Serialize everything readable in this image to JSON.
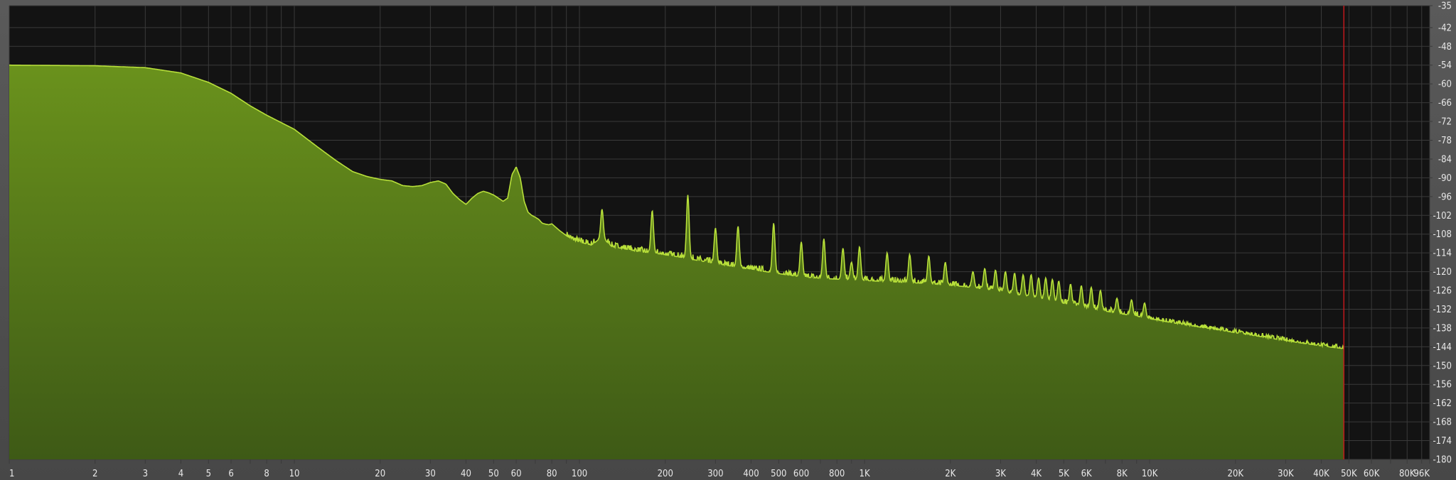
{
  "chart_data": {
    "type": "area",
    "title": "",
    "xlabel": "",
    "ylabel": "",
    "x_scale": "log",
    "y_unit": "dB",
    "xlim": [
      1,
      96000
    ],
    "ylim": [
      -180,
      -35
    ],
    "grid": true,
    "x_tick_labels": [
      {
        "value": 1,
        "label": "1"
      },
      {
        "value": 2,
        "label": "2"
      },
      {
        "value": 3,
        "label": "3"
      },
      {
        "value": 4,
        "label": "4"
      },
      {
        "value": 5,
        "label": "5"
      },
      {
        "value": 6,
        "label": "6"
      },
      {
        "value": 8,
        "label": "8"
      },
      {
        "value": 10,
        "label": "10"
      },
      {
        "value": 20,
        "label": "20"
      },
      {
        "value": 30,
        "label": "30"
      },
      {
        "value": 40,
        "label": "40"
      },
      {
        "value": 50,
        "label": "50"
      },
      {
        "value": 60,
        "label": "60"
      },
      {
        "value": 80,
        "label": "80"
      },
      {
        "value": 100,
        "label": "100"
      },
      {
        "value": 200,
        "label": "200"
      },
      {
        "value": 300,
        "label": "300"
      },
      {
        "value": 400,
        "label": "400"
      },
      {
        "value": 500,
        "label": "500"
      },
      {
        "value": 600,
        "label": "600"
      },
      {
        "value": 800,
        "label": "800"
      },
      {
        "value": 1000,
        "label": "1K"
      },
      {
        "value": 2000,
        "label": "2K"
      },
      {
        "value": 3000,
        "label": "3K"
      },
      {
        "value": 4000,
        "label": "4K"
      },
      {
        "value": 5000,
        "label": "5K"
      },
      {
        "value": 6000,
        "label": "6K"
      },
      {
        "value": 8000,
        "label": "8K"
      },
      {
        "value": 10000,
        "label": "10K"
      },
      {
        "value": 20000,
        "label": "20K"
      },
      {
        "value": 30000,
        "label": "30K"
      },
      {
        "value": 40000,
        "label": "40K"
      },
      {
        "value": 50000,
        "label": "50K"
      },
      {
        "value": 60000,
        "label": "60K"
      },
      {
        "value": 80000,
        "label": "80K"
      },
      {
        "value": 96000,
        "label": "96K"
      }
    ],
    "x_extra_gridlines": [
      7,
      9,
      70,
      90,
      700,
      900,
      7000,
      9000,
      70000,
      90000
    ],
    "y_ticks": [
      -35,
      -42,
      -48,
      -54,
      -60,
      -66,
      -72,
      -78,
      -84,
      -90,
      -96,
      -102,
      -108,
      -114,
      -120,
      -126,
      -132,
      -138,
      -144,
      -150,
      -156,
      -162,
      -168,
      -174,
      -180
    ],
    "nyquist_marker_hz": 48000,
    "colors": {
      "background": "#131313",
      "grid": "#3a3a3a",
      "fill_top": "#6a921c",
      "fill_bottom": "#3e5a16",
      "line": "#b8e03a",
      "marker": "#c0181c",
      "frame": "#4d4d4d"
    },
    "series": [
      {
        "x": [
          1,
          2,
          3,
          4,
          5,
          6,
          7,
          8,
          10,
          12,
          14,
          16,
          18,
          20,
          22,
          24,
          26,
          28,
          30,
          32,
          34,
          36,
          38,
          40,
          42,
          44,
          46,
          48,
          50,
          52,
          54,
          56,
          58,
          60,
          62,
          64,
          66,
          68,
          70,
          72,
          74,
          76,
          78,
          80,
          85,
          90,
          95,
          100,
          110,
          120,
          130,
          140,
          150,
          160,
          170,
          180,
          190,
          200,
          210,
          220,
          230,
          240,
          250,
          260,
          280,
          300,
          320,
          340,
          360,
          400,
          450,
          500,
          550,
          600,
          650,
          700,
          800,
          900,
          1000,
          1100,
          1200,
          1300,
          1400,
          1500,
          1600,
          1700,
          1800,
          1900,
          2000,
          2200,
          2400,
          2600,
          2800,
          3000,
          3200,
          3500,
          4000,
          4500,
          5000,
          5500,
          6000,
          7000,
          8000,
          9000,
          10000,
          12000,
          14000,
          16000,
          18000,
          20000,
          22000,
          24000,
          26000,
          28000,
          30000,
          32000,
          34000,
          36000,
          38000,
          40000,
          42000,
          44000,
          46000,
          48000
        ],
        "values": [
          -54,
          -54.2,
          -54.8,
          -56.5,
          -59.5,
          -63,
          -67,
          -70,
          -74.5,
          -80,
          -84.5,
          -88,
          -89.6,
          -90.5,
          -91,
          -92.5,
          -92.8,
          -92.5,
          -91.5,
          -91,
          -92,
          -95,
          -97,
          -98.5,
          -96.5,
          -95,
          -94.3,
          -94.8,
          -95.5,
          -96.5,
          -97.5,
          -96.5,
          -89,
          -86.5,
          -90,
          -97.5,
          -101,
          -102,
          -102.6,
          -103.3,
          -104.5,
          -104.8,
          -105,
          -104.7,
          -106.8,
          -108.5,
          -109.8,
          -110.5,
          -111.5,
          -109,
          -112,
          -112.5,
          -113,
          -113.5,
          -113.8,
          -114,
          -114.3,
          -114.6,
          -114.9,
          -115.2,
          -115.5,
          -115.8,
          -116.1,
          -116.4,
          -116.9,
          -117.4,
          -117.8,
          -118.2,
          -118.6,
          -119.3,
          -120,
          -120.6,
          -121.2,
          -121.6,
          -121.9,
          -122.1,
          -122.4,
          -122.6,
          -122.8,
          -123,
          -123.2,
          -123.3,
          -123.5,
          -123.6,
          -123.7,
          -123.9,
          -124,
          -124.2,
          -124.4,
          -124.7,
          -125.1,
          -125.5,
          -125.9,
          -126.3,
          -126.8,
          -127.5,
          -128.4,
          -129.3,
          -130.1,
          -130.8,
          -131.5,
          -132.6,
          -133.5,
          -134.2,
          -135,
          -136.3,
          -137.3,
          -138.1,
          -138.8,
          -139.5,
          -140.1,
          -140.6,
          -141.1,
          -141.6,
          -142,
          -142.4,
          -142.8,
          -143.1,
          -143.4,
          -143.7,
          -144,
          -144.2,
          -144.4,
          -144.6
        ]
      }
    ],
    "peaks": [
      {
        "x": 60,
        "y": -86.5
      },
      {
        "x": 120,
        "y": -100
      },
      {
        "x": 180,
        "y": -100.5
      },
      {
        "x": 240,
        "y": -95.5
      },
      {
        "x": 300,
        "y": -106
      },
      {
        "x": 360,
        "y": -105.5
      },
      {
        "x": 480,
        "y": -104.5
      },
      {
        "x": 600,
        "y": -110.5
      },
      {
        "x": 720,
        "y": -109.5
      },
      {
        "x": 840,
        "y": -112.5
      },
      {
        "x": 900,
        "y": -117
      },
      {
        "x": 960,
        "y": -112
      },
      {
        "x": 1200,
        "y": -114
      },
      {
        "x": 1440,
        "y": -114.5
      },
      {
        "x": 1680,
        "y": -115
      },
      {
        "x": 1920,
        "y": -117
      },
      {
        "x": 2400,
        "y": -120
      },
      {
        "x": 2640,
        "y": -119
      },
      {
        "x": 2880,
        "y": -119.5
      },
      {
        "x": 3120,
        "y": -120
      },
      {
        "x": 3360,
        "y": -120.5
      },
      {
        "x": 3600,
        "y": -121
      },
      {
        "x": 3840,
        "y": -121
      },
      {
        "x": 4080,
        "y": -122
      },
      {
        "x": 4320,
        "y": -122
      },
      {
        "x": 4560,
        "y": -122.5
      },
      {
        "x": 4800,
        "y": -123
      },
      {
        "x": 5280,
        "y": -124
      },
      {
        "x": 5760,
        "y": -124.5
      },
      {
        "x": 6240,
        "y": -125
      },
      {
        "x": 6720,
        "y": -126
      },
      {
        "x": 7680,
        "y": -128.5
      },
      {
        "x": 8640,
        "y": -129
      },
      {
        "x": 9600,
        "y": -130
      },
      {
        "x": 21000,
        "y": -139
      },
      {
        "x": 31000,
        "y": -143
      },
      {
        "x": 41500,
        "y": -143.5
      }
    ]
  }
}
